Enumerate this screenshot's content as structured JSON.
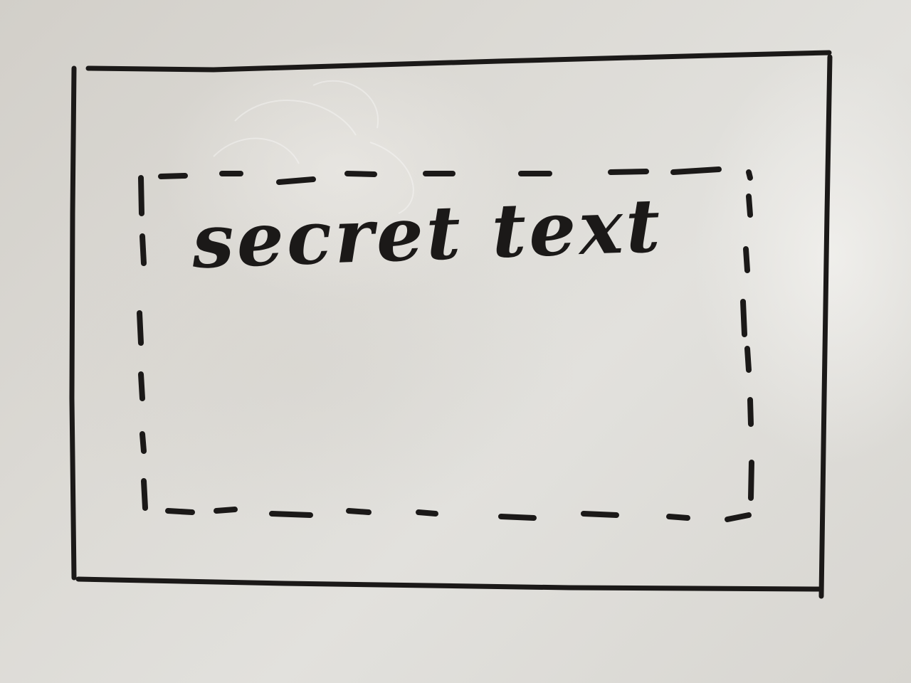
{
  "board": {
    "handwritten_text": "secret text"
  },
  "colors": {
    "marker": "#1b1918",
    "board": "#dcdad5"
  }
}
